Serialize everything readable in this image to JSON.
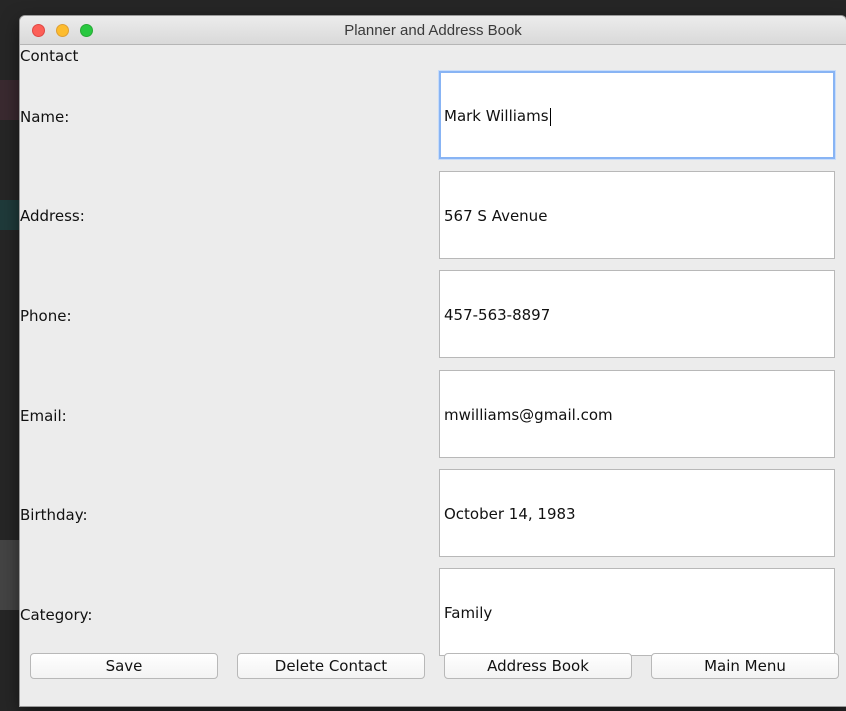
{
  "window": {
    "title": "Planner and Address Book"
  },
  "section": {
    "label": "Contact"
  },
  "fields": [
    {
      "label": "Name:",
      "value": "Mark Williams",
      "focused": true
    },
    {
      "label": "Address:",
      "value": "567 S Avenue"
    },
    {
      "label": "Phone:",
      "value": "457-563-8897"
    },
    {
      "label": "Email:",
      "value": "mwilliams@gmail.com"
    },
    {
      "label": "Birthday:",
      "value": "October 14, 1983"
    },
    {
      "label": "Category:",
      "value": "Family"
    }
  ],
  "buttons": {
    "save": "Save",
    "delete": "Delete Contact",
    "address_book": "Address Book",
    "main_menu": "Main Menu"
  },
  "colors": {
    "focus_ring": "#88b4f4",
    "traffic_close": "#fc5f57",
    "traffic_minimize": "#fdbc2e",
    "traffic_zoom": "#28c840"
  }
}
